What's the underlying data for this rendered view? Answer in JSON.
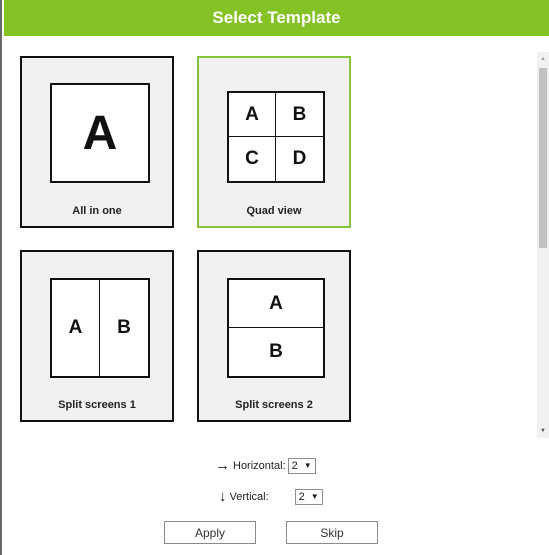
{
  "dialog": {
    "title": "Select Template"
  },
  "templates": [
    {
      "label": "All in one",
      "cells": [
        "A"
      ],
      "selected": false
    },
    {
      "label": "Quad view",
      "cells": [
        "A",
        "B",
        "C",
        "D"
      ],
      "selected": true
    },
    {
      "label": "Split screens 1",
      "cells": [
        "A",
        "B"
      ],
      "selected": false
    },
    {
      "label": "Split screens 2",
      "cells": [
        "A",
        "B"
      ],
      "selected": false
    }
  ],
  "controls": {
    "horizontal": {
      "arrow": "→",
      "label": "Horizontal:",
      "value": "2",
      "caret": "▼"
    },
    "vertical": {
      "arrow": "↓",
      "label": "Vertical:",
      "value": "2",
      "caret": "▼"
    }
  },
  "buttons": {
    "apply": "Apply",
    "skip": "Skip"
  },
  "scrollbar": {
    "up_glyph": "▲",
    "down_glyph": "▼"
  },
  "colors": {
    "accent": "#85c226",
    "selected_border": "#86c23b",
    "card_bg": "#f1f1f1"
  }
}
